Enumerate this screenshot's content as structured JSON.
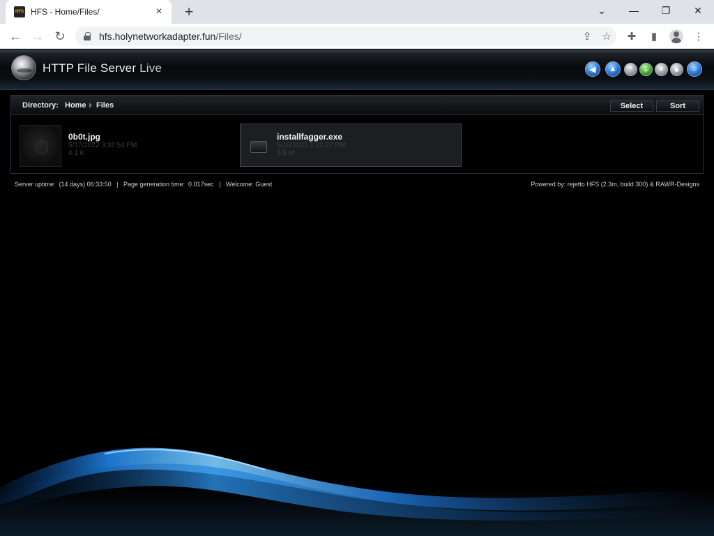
{
  "browser": {
    "tab_title": "HFS - Home/Files/",
    "favicon_text": "HFS",
    "new_tab": "+",
    "url_host": "hfs.holynetworkadapter.fun",
    "url_path": "/Files/"
  },
  "header": {
    "title_main": "HTTP File Server",
    "title_live": "Live"
  },
  "directory": {
    "label": "Directory:",
    "crumbs": [
      "Home",
      "Files"
    ],
    "select_label": "Select",
    "sort_label": "Sort"
  },
  "files": [
    {
      "name": "0b0t.jpg",
      "date": "5/17/2022 3:32:54 PM",
      "size": "4.1 K"
    },
    {
      "name": "installfagger.exe",
      "date": "5/16/2022 1:22:27 PM",
      "size": "5.9 M"
    }
  ],
  "footer": {
    "uptime_label": "Server uptime:",
    "uptime_value": "(14 days) 06:33:50",
    "gen_label": "Page generation time:",
    "gen_value": "0.017sec",
    "welcome_label": "Welcome:",
    "welcome_value": "Guest",
    "powered": "Powered by: rejetto HFS (2.3m, build 300) & RAWR-Designs"
  }
}
